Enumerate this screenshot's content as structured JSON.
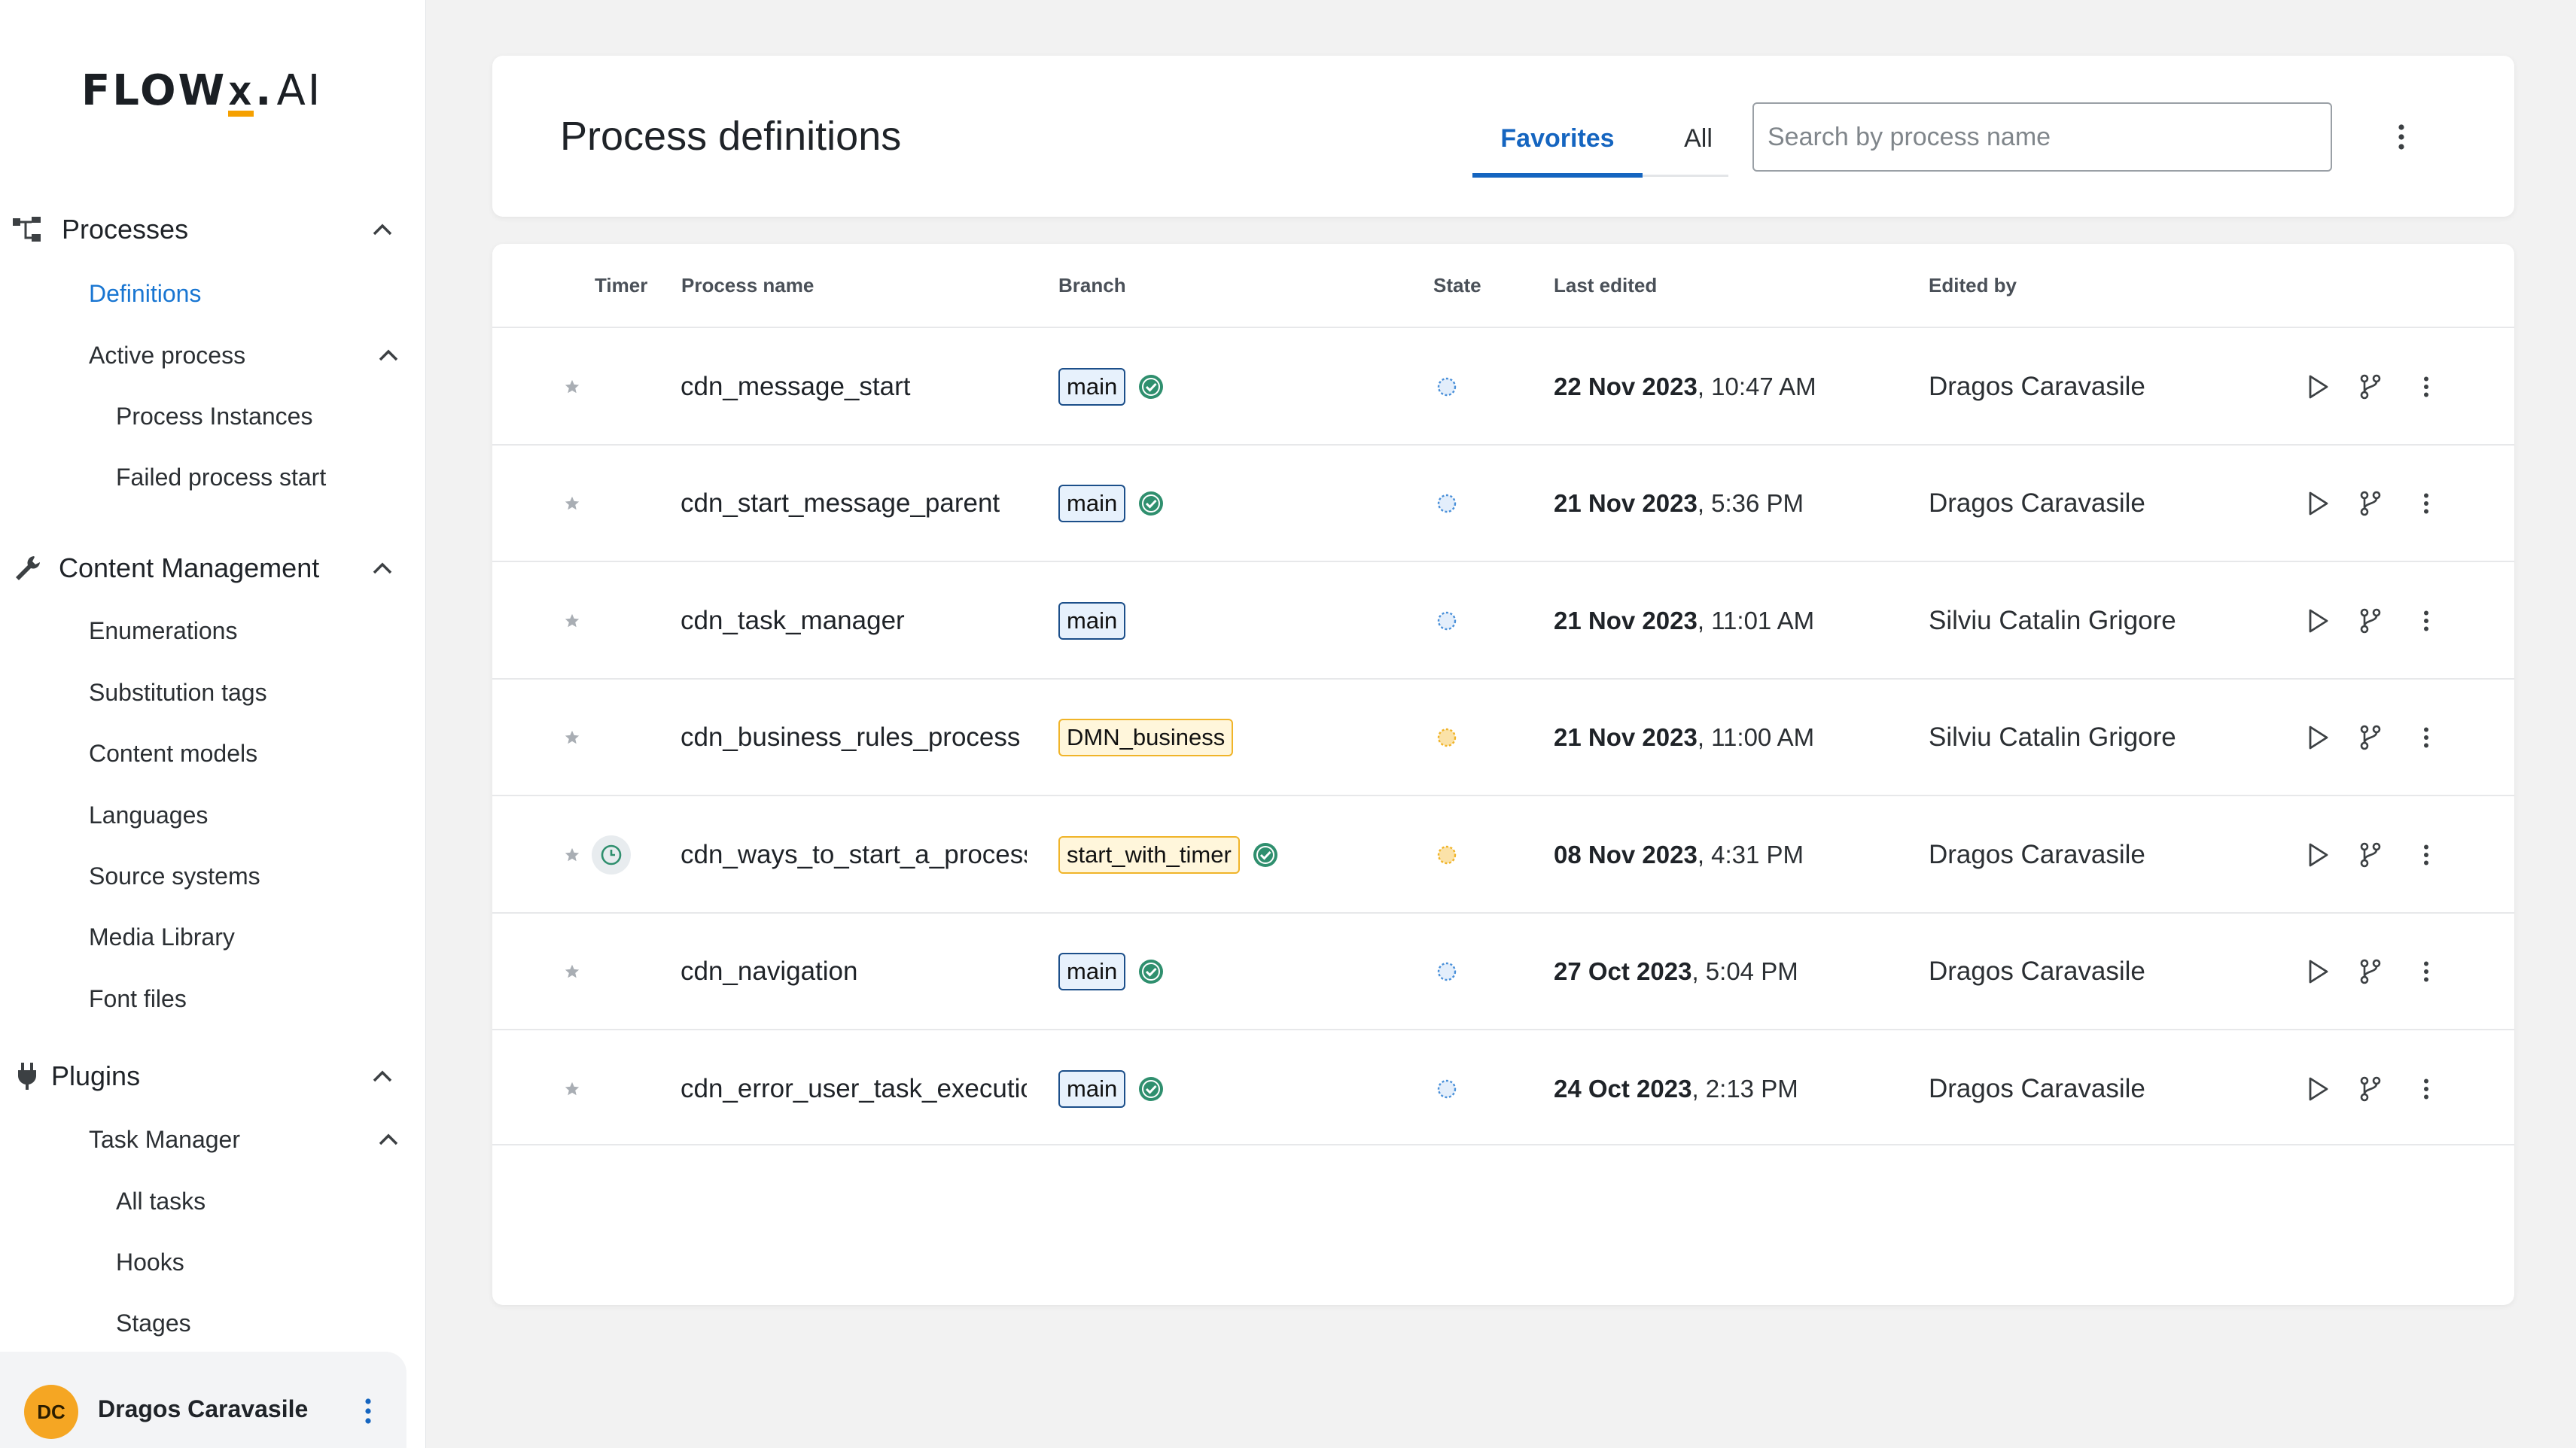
{
  "app": {
    "logo": {
      "part1": "FLOW",
      "x": "X",
      "part2": "AI",
      "accent": "#f5a000"
    },
    "accent_color": "#1565c0"
  },
  "sidebar": {
    "groups": [
      {
        "label": "Processes",
        "icon": "process-tree-icon",
        "expanded": true,
        "items": [
          {
            "label": "Definitions",
            "active": true
          },
          {
            "label": "Active process",
            "expanded": true,
            "children": [
              {
                "label": "Process Instances"
              },
              {
                "label": "Failed process start"
              }
            ]
          }
        ]
      },
      {
        "label": "Content Management",
        "icon": "wrench-icon",
        "expanded": true,
        "items": [
          {
            "label": "Enumerations"
          },
          {
            "label": "Substitution tags"
          },
          {
            "label": "Content models"
          },
          {
            "label": "Languages"
          },
          {
            "label": "Source systems"
          },
          {
            "label": "Media Library"
          },
          {
            "label": "Font files"
          }
        ]
      },
      {
        "label": "Plugins",
        "icon": "plug-icon",
        "expanded": true,
        "items": [
          {
            "label": "Task Manager",
            "expanded": true,
            "children": [
              {
                "label": "All tasks"
              },
              {
                "label": "Hooks"
              },
              {
                "label": "Stages"
              }
            ]
          }
        ]
      }
    ],
    "user": {
      "initials": "DC",
      "name": "Dragos Caravasile",
      "avatar_color": "#f5a623"
    }
  },
  "header": {
    "title": "Process definitions",
    "tabs": [
      {
        "label": "Favorites",
        "active": true
      },
      {
        "label": "All",
        "active": false
      }
    ],
    "search": {
      "placeholder": "Search by process name",
      "value": ""
    }
  },
  "table": {
    "columns": {
      "timer": "Timer",
      "name": "Process name",
      "branch": "Branch",
      "state": "State",
      "last_edited": "Last edited",
      "edited_by": "Edited by"
    },
    "rows": [
      {
        "name": "cdn_message_start",
        "branch": "main",
        "branch_color": "blue",
        "branch_ok": true,
        "timer": false,
        "state": "draft-blue",
        "date": "22 Nov 2023",
        "time": ", 10:47 AM",
        "editor": "Dragos Caravasile"
      },
      {
        "name": "cdn_start_message_parent",
        "branch": "main",
        "branch_color": "blue",
        "branch_ok": true,
        "timer": false,
        "state": "draft-blue",
        "date": "21 Nov 2023",
        "time": ", 5:36 PM",
        "editor": "Dragos Caravasile"
      },
      {
        "name": "cdn_task_manager",
        "branch": "main",
        "branch_color": "blue",
        "branch_ok": false,
        "timer": false,
        "state": "draft-blue",
        "date": "21 Nov 2023",
        "time": ", 11:01 AM",
        "editor": "Silviu Catalin Grigore"
      },
      {
        "name": "cdn_business_rules_process",
        "branch": "DMN_business",
        "branch_color": "yellow",
        "branch_ok": false,
        "timer": false,
        "state": "draft-yellow",
        "date": "21 Nov 2023",
        "time": ", 11:00 AM",
        "editor": "Silviu Catalin Grigore"
      },
      {
        "name": "cdn_ways_to_start_a_process",
        "branch": "start_with_timer",
        "branch_color": "yellow",
        "branch_ok": true,
        "timer": true,
        "state": "draft-yellow",
        "date": "08 Nov 2023",
        "time": ", 4:31 PM",
        "editor": "Dragos Caravasile"
      },
      {
        "name": "cdn_navigation",
        "branch": "main",
        "branch_color": "blue",
        "branch_ok": true,
        "timer": false,
        "state": "draft-blue",
        "date": "27 Oct 2023",
        "time": ", 5:04 PM",
        "editor": "Dragos Caravasile"
      },
      {
        "name": "cdn_error_user_task_execution",
        "branch": "main",
        "branch_color": "blue",
        "branch_ok": true,
        "timer": false,
        "state": "draft-blue",
        "date": "24 Oct 2023",
        "time": ", 2:13 PM",
        "editor": "Dragos Caravasile"
      }
    ]
  }
}
